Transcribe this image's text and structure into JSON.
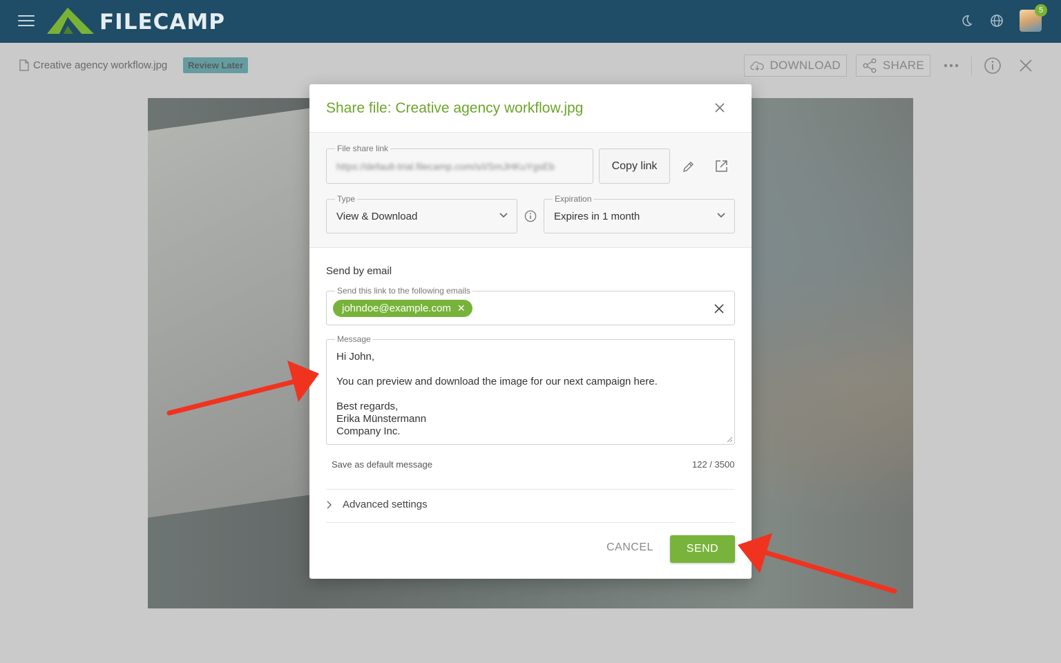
{
  "app": {
    "brand": "FILECAMP",
    "notification_count": "5"
  },
  "file": {
    "name": "Creative agency workflow.jpg",
    "tag": "Review Later"
  },
  "toolbar": {
    "download_label": "DOWNLOAD",
    "share_label": "SHARE"
  },
  "modal": {
    "title": "Share file: Creative agency workflow.jpg",
    "share_link": {
      "legend": "File share link",
      "url": "https://default-trial.filecamp.com/s/i/SmJHKuYgsEb",
      "copy_label": "Copy link"
    },
    "type": {
      "legend": "Type",
      "value": "View & Download"
    },
    "expiration": {
      "legend": "Expiration",
      "value": "Expires in 1 month"
    },
    "email_section": {
      "title": "Send by email",
      "recipients_legend": "Send this link to the following emails",
      "recipients": [
        "johndoe@example.com"
      ],
      "message_legend": "Message",
      "message_lines": [
        "Hi John,",
        "You can preview and download the image for our next campaign here.",
        "Best regards,",
        "Erika Münstermann",
        "Company Inc."
      ],
      "save_default_label": "Save as default message",
      "char_count": "122 / 3500"
    },
    "advanced_label": "Advanced settings",
    "cancel_label": "CANCEL",
    "send_label": "SEND"
  },
  "colors": {
    "topbar": "#1f4c66",
    "accent_green": "#78b43c",
    "title_green": "#6ea42b",
    "tag_teal": "#3fa1a8",
    "annotation_arrow": "#f0331f"
  },
  "icons": [
    "menu-icon",
    "filecamp-logo",
    "moon-icon",
    "globe-icon",
    "avatar",
    "file-icon",
    "cloud-download-icon",
    "share-icon",
    "more-icon",
    "info-icon",
    "close-icon",
    "pencil-icon",
    "external-link-icon",
    "chevron-down-icon",
    "chevron-right-icon"
  ]
}
